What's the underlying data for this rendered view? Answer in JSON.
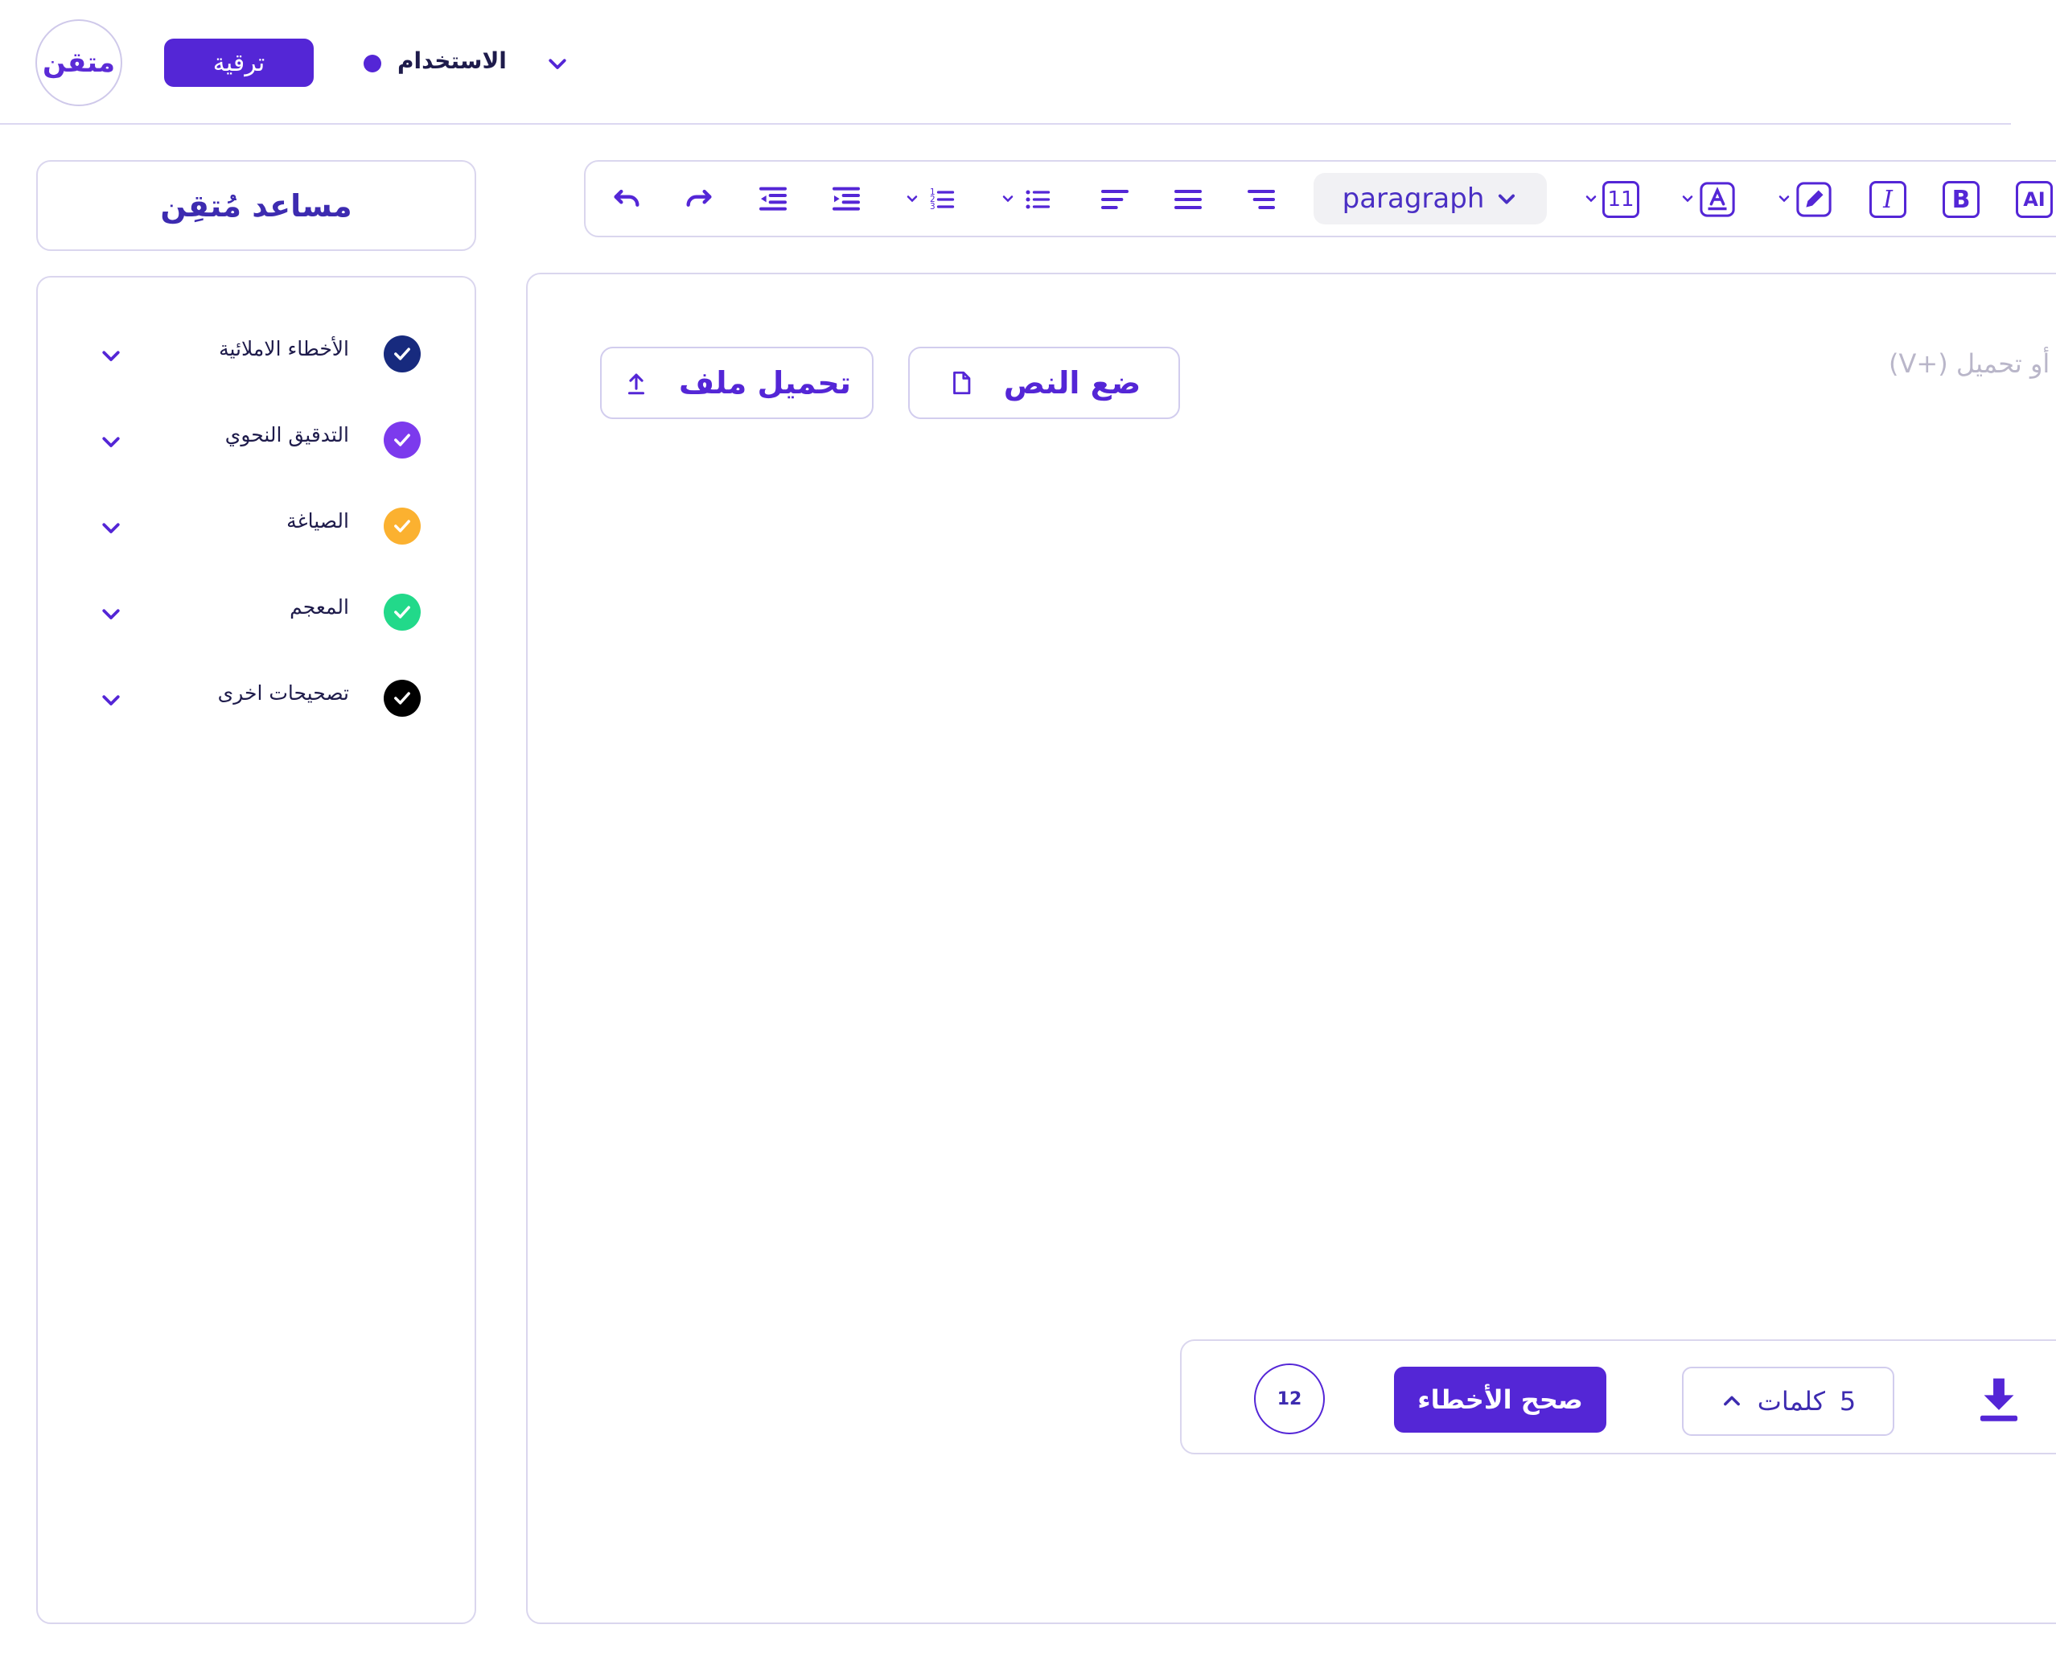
{
  "header": {
    "logo_text": "متقن",
    "upgrade_label": "ترقية",
    "usage_label": "الاستخدام",
    "accent_color": "#5426d6"
  },
  "assistant": {
    "title": "مساعد مُتقِن",
    "categories": [
      {
        "label": "الأخطاء الاملائية",
        "color": "#172a7e"
      },
      {
        "label": "التدقيق النحوي",
        "color": "#7c3aed"
      },
      {
        "label": "الصياغة",
        "color": "#fbb130"
      },
      {
        "label": "المعجم",
        "color": "#22d98a"
      },
      {
        "label": "تصحيحات اخرى",
        "color": "#000000"
      }
    ]
  },
  "toolbar": {
    "paragraph_label": "paragraph",
    "font_size": "11",
    "ai_label": "AI",
    "bold_label": "B",
    "italic_label": "I"
  },
  "editor": {
    "placeholder": "(V+) أو تحميل",
    "paste_label": "ضع النص",
    "upload_label": "تحميل ملف"
  },
  "status": {
    "error_count": "12",
    "fix_label": "صحح الأخطاء",
    "word_count": "5",
    "words_label": "كلمات"
  }
}
